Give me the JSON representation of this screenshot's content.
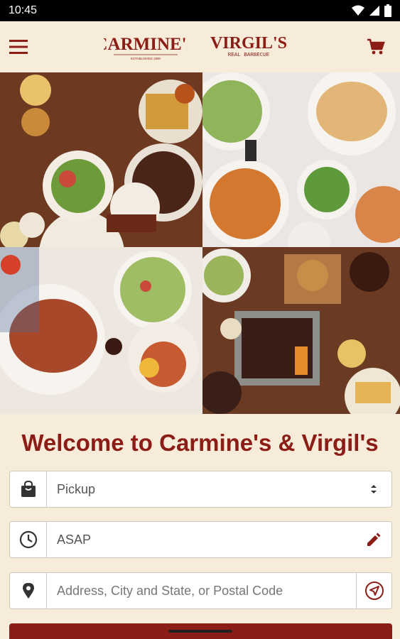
{
  "status_bar": {
    "time": "10:45"
  },
  "header": {
    "logo_carmines_text": "CARMINE'S",
    "logo_carmines_sub": "ESTABLISHED 1990",
    "logo_virgils_text": "VIRGIL'S",
    "logo_virgils_sub": "REAL BARBECUE"
  },
  "welcome": {
    "title": "Welcome to Carmine's & Virgil's"
  },
  "order_type": {
    "value": "Pickup",
    "icon": "shopping-bag-icon"
  },
  "time": {
    "value": "ASAP",
    "icon": "clock-icon"
  },
  "address": {
    "placeholder": "Address, City and State, or Postal Code",
    "icon": "location-pin-icon"
  },
  "colors": {
    "brand_red": "#8c1c16",
    "background": "#f6ecd9"
  }
}
